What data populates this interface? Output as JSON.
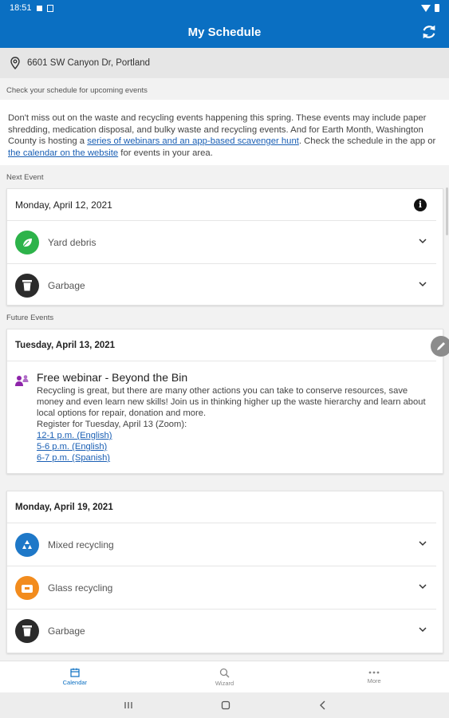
{
  "status_bar": {
    "time": "18:51"
  },
  "app_bar": {
    "title": "My Schedule",
    "refresh_icon": "refresh-icon"
  },
  "address": {
    "text": "6601 SW Canyon Dr, Portland",
    "icon": "location-pin-icon"
  },
  "hint": "Check your schedule for upcoming events",
  "intro": {
    "text_1": "Don't miss out on the waste and recycling events happening this spring. These events may include paper shredding, medication disposal, and bulky waste and recycling events. And for Earth Month, Washington County is hosting a ",
    "link_1": "series of webinars and an app-based scavenger hunt",
    "text_2": ". Check the schedule in the app or ",
    "link_2": "the calendar on the website",
    "text_3": " for events in your area."
  },
  "next_event": {
    "section_label": "Next Event",
    "date": "Monday, April 12, 2021",
    "items": [
      {
        "label": "Yard debris",
        "icon": "leaf-icon",
        "color": "#2db34a"
      },
      {
        "label": "Garbage",
        "icon": "trash-can-icon",
        "color": "#2b2b2b"
      }
    ]
  },
  "future_events": {
    "section_label": "Future Events",
    "webinar_card": {
      "date": "Tuesday, April 13, 2021",
      "icon": "people-icon",
      "icon_color": "#8e24aa",
      "title": "Free webinar - Beyond the Bin",
      "body_1": "Recycling is great, but there are many other actions you can take to conserve resources, save money and even learn new skills! Join us in thinking higher up the waste hierarchy and learn about local options for repair, donation and more.",
      "body_2": "Register for Tuesday, April 13 (Zoom):",
      "links": [
        "12-1 p.m. (English)",
        "5-6 p.m. (English)",
        "6-7 p.m. (Spanish)"
      ]
    },
    "collection_card": {
      "date": "Monday, April 19, 2021",
      "items": [
        {
          "label": "Mixed recycling",
          "icon": "recycle-icon",
          "color": "#1e78c8"
        },
        {
          "label": "Glass recycling",
          "icon": "glass-bin-icon",
          "color": "#f28c1e"
        },
        {
          "label": "Garbage",
          "icon": "trash-can-icon",
          "color": "#2b2b2b"
        }
      ]
    }
  },
  "bottom_nav": {
    "items": [
      {
        "label": "Calendar",
        "icon": "calendar-icon",
        "active": true
      },
      {
        "label": "Wizard",
        "icon": "search-icon",
        "active": false
      },
      {
        "label": "More",
        "icon": "more-icon",
        "active": false
      }
    ]
  }
}
